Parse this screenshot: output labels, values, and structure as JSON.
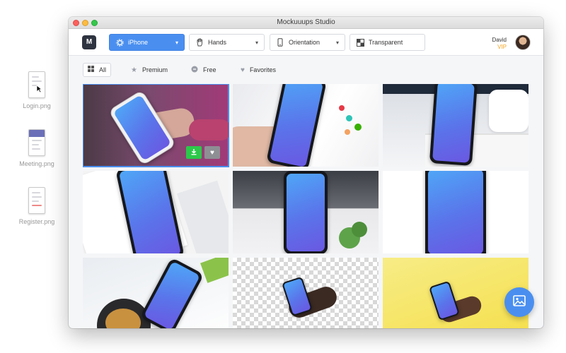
{
  "desktop": {
    "files": [
      {
        "name": "Login.png"
      },
      {
        "name": "Meeting.png"
      },
      {
        "name": "Register.png"
      }
    ]
  },
  "window": {
    "title": "Mockuuups Studio",
    "logo_letter": "M"
  },
  "toolbar": {
    "device": {
      "label": "iPhone",
      "icon": "gear-icon"
    },
    "hands": {
      "label": "Hands",
      "icon": "hand-icon"
    },
    "orientation": {
      "label": "Orientation",
      "icon": "phone-icon"
    },
    "background": {
      "label": "Transparent",
      "icon": "transparent-icon"
    }
  },
  "user": {
    "name": "David",
    "badge": "VIP",
    "badge_color": "#f5a623"
  },
  "filters": [
    {
      "label": "All",
      "icon": "grid-icon",
      "active": true
    },
    {
      "label": "Premium",
      "icon": "star-icon",
      "active": false
    },
    {
      "label": "Free",
      "icon": "circle-icon",
      "active": false
    },
    {
      "label": "Favorites",
      "icon": "heart-icon",
      "active": false
    }
  ],
  "tile_actions": {
    "download_icon": "download-icon",
    "favorite_icon": "heart-icon",
    "download_color": "#2cc84a"
  },
  "accent_color": "#4a8ff0",
  "fab": {
    "icon": "image-icon"
  }
}
